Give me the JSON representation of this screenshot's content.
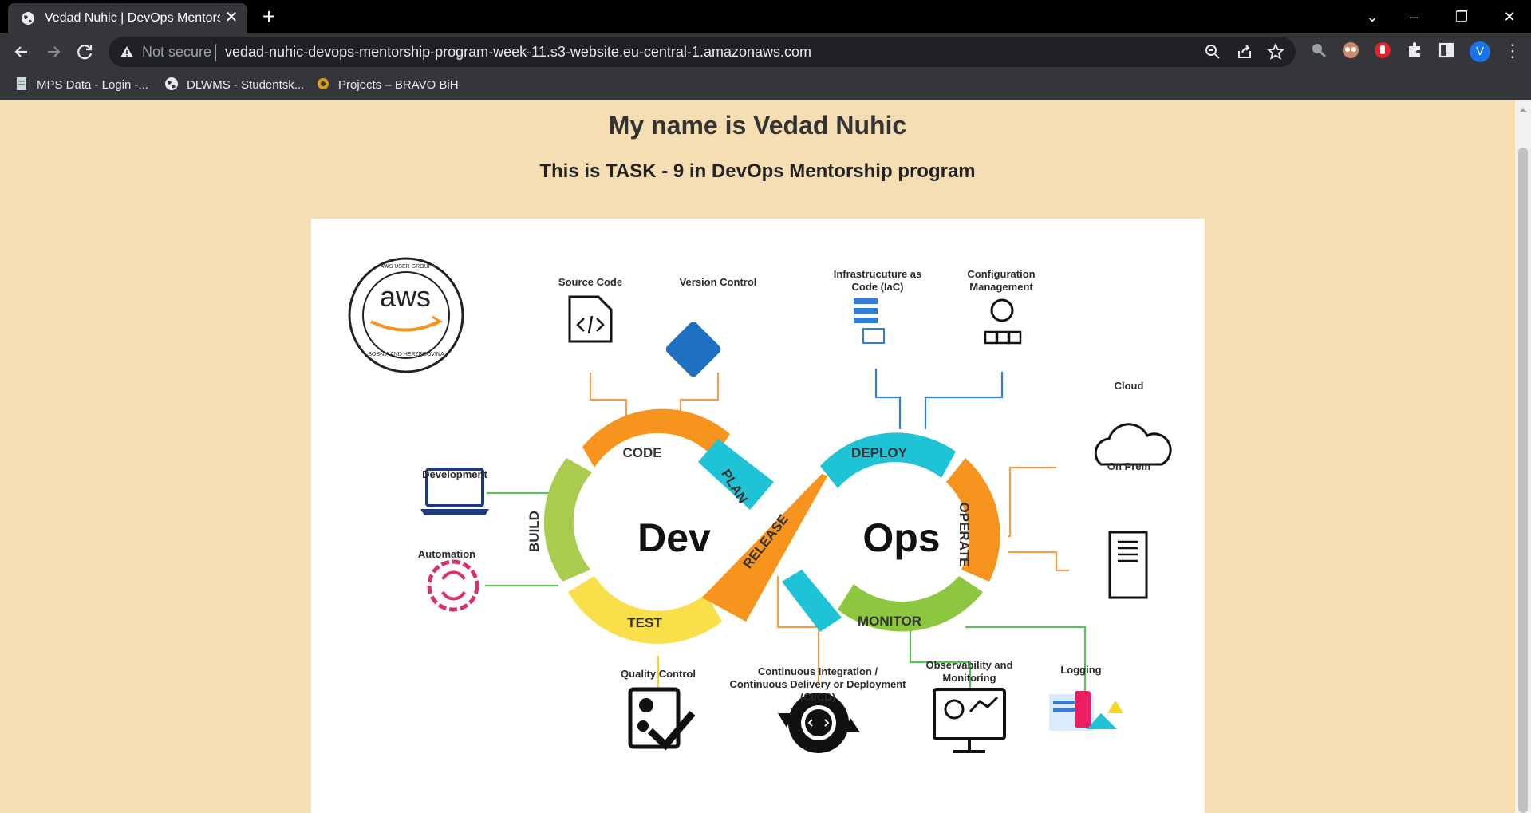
{
  "browser": {
    "tab_title": "Vedad Nuhic | DevOps Mentorship",
    "tab_close": "✕",
    "new_tab": "+",
    "security_label": "Not secure",
    "url": "vedad-nuhic-devops-mentorship-program-week-11.s3-website.eu-central-1.amazonaws.com",
    "profile_initial": "V",
    "bookmarks": [
      {
        "label": "MPS Data - Login -...",
        "icon": "document-icon"
      },
      {
        "label": "DLWMS - Studentsk...",
        "icon": "globe-icon"
      },
      {
        "label": "Projects – BRAVO BiH",
        "icon": "site-icon"
      }
    ]
  },
  "page": {
    "heading": "My name is Vedad Nuhic",
    "subheading": "This is TASK - 9 in DevOps Mentorship program"
  },
  "diagram": {
    "center_left": "Dev",
    "center_right": "Ops",
    "phases": {
      "code": "CODE",
      "plan": "PLAN",
      "build": "BUILD",
      "test": "TEST",
      "release": "RELEASE",
      "deploy": "DEPLOY",
      "operate": "OPERATE",
      "monitor": "MONITOR"
    },
    "logo": {
      "main": "aws",
      "ring_top": "AWS USER GROUP",
      "ring_bottom": "BOSNIA AND HERZEGOVINA"
    },
    "labels": {
      "source_code": "Source Code",
      "version_control": "Version Control",
      "iac_line1": "Infrastrucuture as",
      "iac_line2": "Code (IaC)",
      "config_line1": "Configuration",
      "config_line2": "Management",
      "cloud": "Cloud",
      "on_prem": "On Prem",
      "development": "Development",
      "automation": "Automation",
      "quality_control": "Quality Control",
      "cicd_line1": "Continuous Integration /",
      "cicd_line2": "Continuous Delivery or Deployment",
      "cicd_line3": "(CI/CD)",
      "observability_line1": "Observability and",
      "observability_line2": "Monitoring",
      "logging": "Logging"
    },
    "colors": {
      "orange": "#f7941d",
      "teal": "#1fc3d6",
      "green": "#8dc63f",
      "yellow": "#f9d71c",
      "blue_git": "#1e70c1",
      "line_orange": "#f0a04b",
      "line_blue": "#2f7ed8",
      "line_green": "#5bc25b"
    }
  }
}
